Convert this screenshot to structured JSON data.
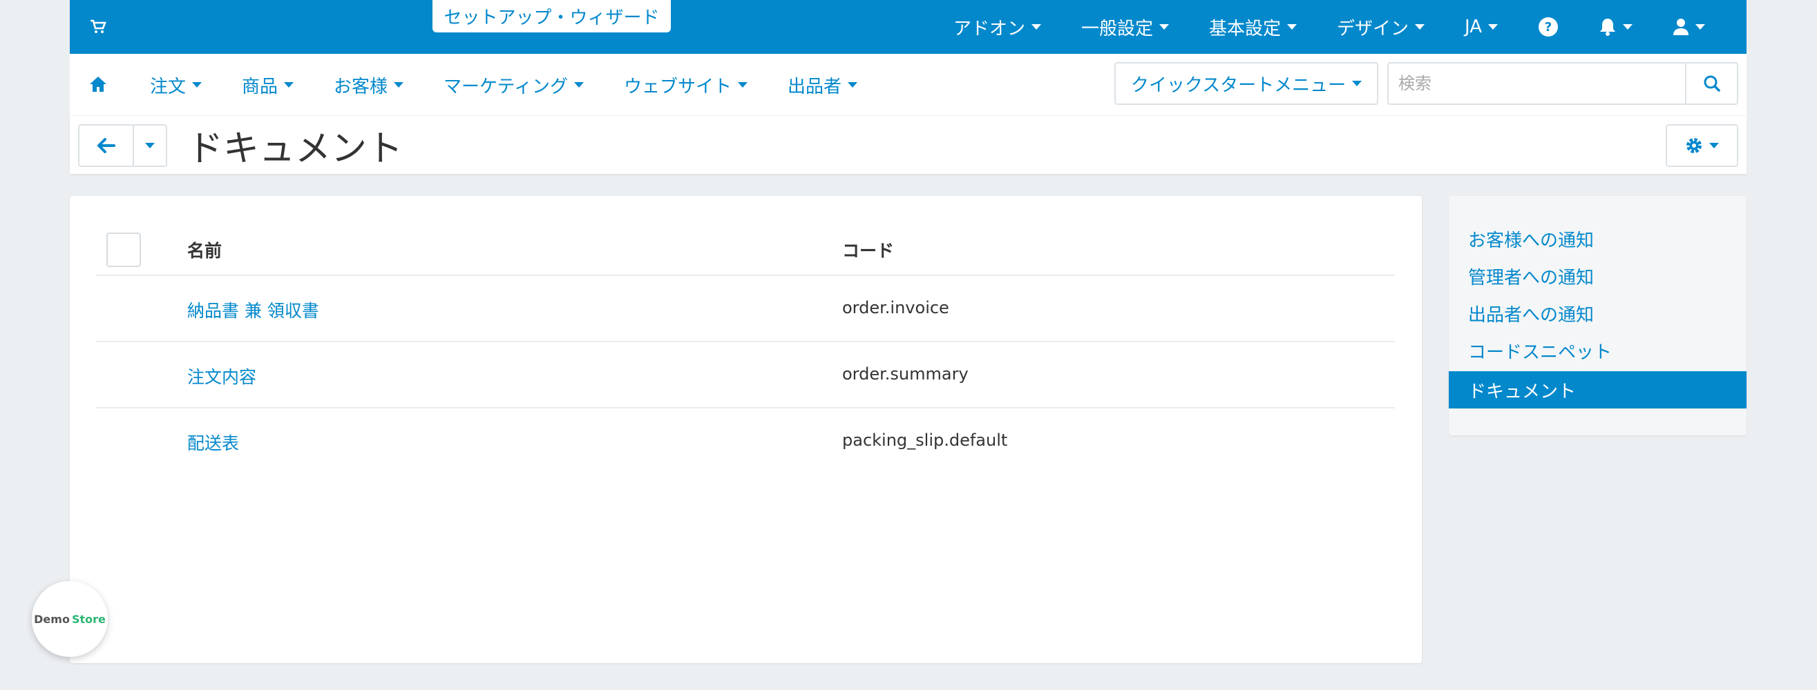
{
  "topbar": {
    "wizard_label": "セットアップ・ウィザード",
    "menu": [
      {
        "label": "アドオン"
      },
      {
        "label": "一般設定"
      },
      {
        "label": "基本設定"
      },
      {
        "label": "デザイン"
      },
      {
        "label": "JA"
      }
    ],
    "icons": [
      "cart-icon",
      "help-icon",
      "bell-icon",
      "user-icon"
    ]
  },
  "navbar": {
    "items": [
      {
        "label": "注文"
      },
      {
        "label": "商品"
      },
      {
        "label": "お客様"
      },
      {
        "label": "マーケティング"
      },
      {
        "label": "ウェブサイト"
      },
      {
        "label": "出品者"
      }
    ],
    "quickstart_label": "クイックスタートメニュー",
    "search_placeholder": "検索"
  },
  "page": {
    "title": "ドキュメント"
  },
  "table": {
    "columns": {
      "name": "名前",
      "code": "コード"
    },
    "rows": [
      {
        "name": "納品書 兼 領収書",
        "code": "order.invoice"
      },
      {
        "name": "注文内容",
        "code": "order.summary"
      },
      {
        "name": "配送表",
        "code": "packing_slip.default"
      }
    ]
  },
  "sidebar": {
    "items": [
      {
        "label": "お客様への通知"
      },
      {
        "label": "管理者への通知"
      },
      {
        "label": "出品者への通知"
      },
      {
        "label": "コードスニペット"
      },
      {
        "label": "ドキュメント",
        "active": true
      }
    ]
  },
  "badge": {
    "demo": "Demo",
    "store": "Store"
  },
  "colors": {
    "accent": "#0388cc",
    "background": "#eceff2",
    "store_green": "#2bb673"
  }
}
